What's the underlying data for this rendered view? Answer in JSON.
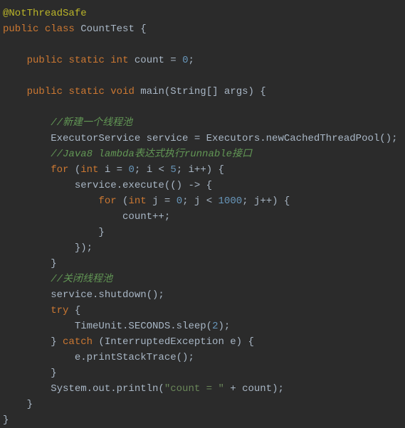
{
  "code": {
    "annotation": "@NotThreadSafe",
    "kw_public": "public",
    "kw_class": "class",
    "kw_static": "static",
    "kw_int": "int",
    "kw_void": "void",
    "kw_for": "for",
    "kw_try": "try",
    "kw_catch": "catch",
    "class_name": " CountTest {",
    "count_decl_pre": " count = ",
    "count_decl_val": "0",
    "count_decl_post": ";",
    "main_sig": " main(String[] args) {",
    "comment1": "//新建一个线程池",
    "line_executor": "        ExecutorService service = Executors.newCachedThreadPool();",
    "comment2": "//Java8 lambda表达式执行runnable接口",
    "for_space": " (",
    "for1_init": " i = ",
    "for1_init_val": "0",
    "for1_cond": "; i < ",
    "for1_cond_val": "5",
    "for1_post": "; i++) {",
    "line_execute": "            service.execute(() -> {",
    "for2_init": " j = ",
    "for2_init_val": "0",
    "for2_cond": "; j < ",
    "for2_cond_val": "1000",
    "for2_post": "; j++) {",
    "line_countinc": "                    count++;",
    "line_close_brace16": "                }",
    "line_close_lambda": "            });",
    "line_close_brace8": "        }",
    "comment3": "//关闭线程池",
    "line_shutdown": "        service.shutdown();",
    "try_post": " {",
    "line_sleep_pre": "            TimeUnit.SECONDS.sleep(",
    "sleep_val": "2",
    "line_sleep_post": ");",
    "catch_pre": "        } ",
    "catch_post": " (InterruptedException e) {",
    "line_printstack": "            e.printStackTrace();",
    "line_print_pre": "        System.out.println(",
    "print_string": "\"count = \"",
    "line_print_post": " + count);",
    "line_close_brace4": "    }",
    "line_close_brace0": "}",
    "indent4": "    ",
    "indent8": "        ",
    "indent16": "                "
  }
}
